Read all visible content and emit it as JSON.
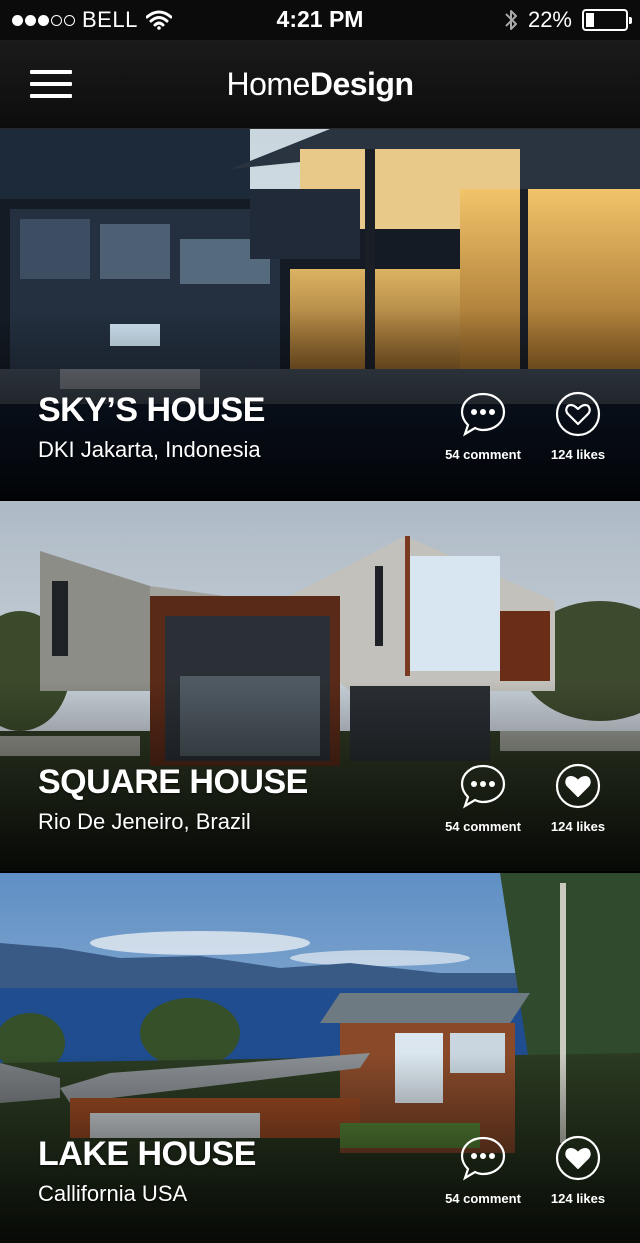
{
  "status_bar": {
    "carrier": "BELL",
    "time": "4:21 PM",
    "battery_percent_text": "22%",
    "battery_level": 0.22,
    "signal_bars": 3,
    "signal_max": 5,
    "icons": [
      "wifi-icon",
      "bluetooth-icon",
      "battery-icon"
    ]
  },
  "nav": {
    "brand_light": "Home",
    "brand_bold": "Design",
    "menu_icon": "hamburger-icon"
  },
  "houses": [
    {
      "title": "SKY’S HOUSE",
      "location": "DKI Jakarta, Indonesia",
      "comments": "54 comment",
      "likes": "124 likes",
      "liked": false
    },
    {
      "title": "SQUARE HOUSE",
      "location": "Rio De Jeneiro, Brazil",
      "comments": "54 comment",
      "likes": "124 likes",
      "liked": true
    },
    {
      "title": "LAKE HOUSE",
      "location": "Callifornia USA",
      "comments": "54 comment",
      "likes": "124 likes",
      "liked": true
    }
  ]
}
